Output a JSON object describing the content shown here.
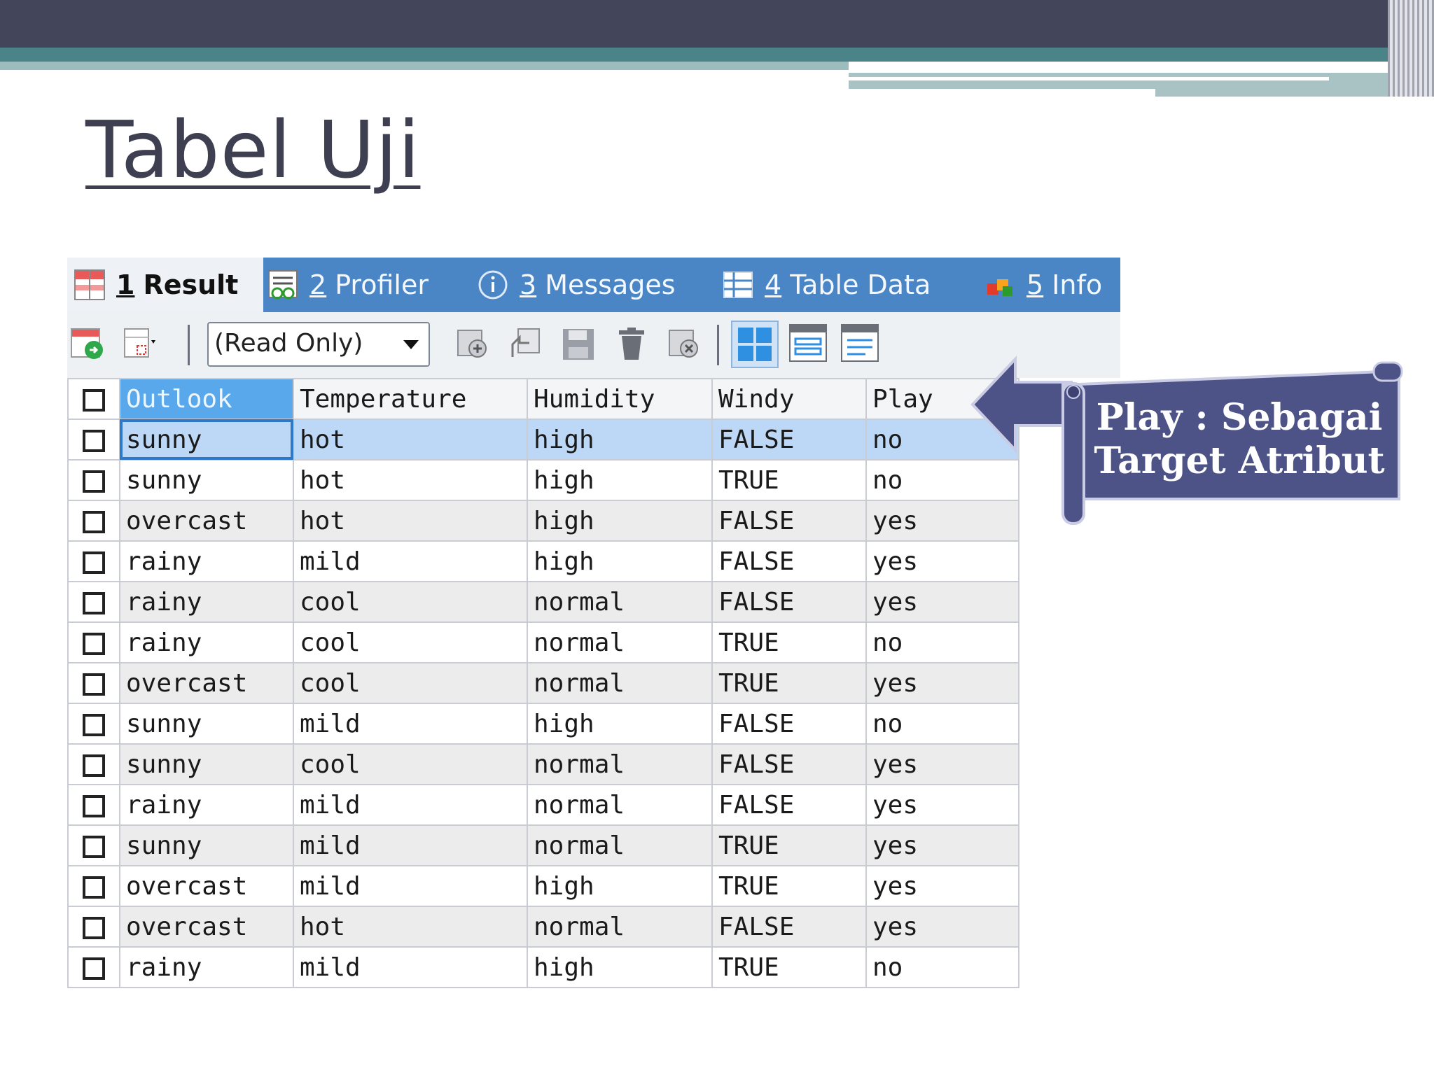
{
  "slide": {
    "title": "Tabel Uji"
  },
  "tabs": [
    {
      "num": "1",
      "label": "Result",
      "icon": "result-grid-icon"
    },
    {
      "num": "2",
      "label": "Profiler",
      "icon": "profiler-icon"
    },
    {
      "num": "3",
      "label": "Messages",
      "icon": "info-circle-icon"
    },
    {
      "num": "4",
      "label": "Table Data",
      "icon": "table-icon"
    },
    {
      "num": "5",
      "label": "Info",
      "icon": "info-cubes-icon"
    }
  ],
  "toolbar": {
    "mode_select": "(Read Only)"
  },
  "table": {
    "columns": [
      "Outlook",
      "Temperature",
      "Humidity",
      "Windy",
      "Play"
    ],
    "rows": [
      [
        "sunny",
        "hot",
        "high",
        "FALSE",
        "no"
      ],
      [
        "sunny",
        "hot",
        "high",
        "TRUE",
        "no"
      ],
      [
        "overcast",
        "hot",
        "high",
        "FALSE",
        "yes"
      ],
      [
        "rainy",
        "mild",
        "high",
        "FALSE",
        "yes"
      ],
      [
        "rainy",
        "cool",
        "normal",
        "FALSE",
        "yes"
      ],
      [
        "rainy",
        "cool",
        "normal",
        "TRUE",
        "no"
      ],
      [
        "overcast",
        "cool",
        "normal",
        "TRUE",
        "yes"
      ],
      [
        "sunny",
        "mild",
        "high",
        "FALSE",
        "no"
      ],
      [
        "sunny",
        "cool",
        "normal",
        "FALSE",
        "yes"
      ],
      [
        "rainy",
        "mild",
        "normal",
        "FALSE",
        "yes"
      ],
      [
        "sunny",
        "mild",
        "normal",
        "TRUE",
        "yes"
      ],
      [
        "overcast",
        "mild",
        "high",
        "TRUE",
        "yes"
      ],
      [
        "overcast",
        "hot",
        "normal",
        "FALSE",
        "yes"
      ],
      [
        "rainy",
        "mild",
        "high",
        "TRUE",
        "no"
      ]
    ]
  },
  "callout": {
    "line1": "Play : Sebagai",
    "line2": "Target Atribut"
  },
  "colors": {
    "tabbar": "#4a86c6",
    "selected_header": "#5aa8ec",
    "selected_row": "#bcd8f6",
    "callout": "#4e5387"
  }
}
